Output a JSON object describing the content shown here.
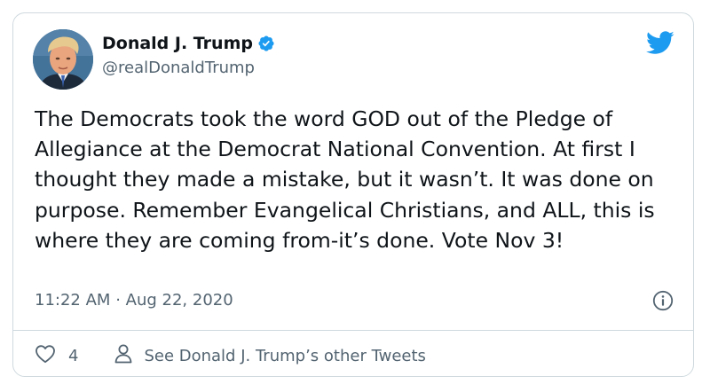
{
  "user": {
    "display_name": "Donald J. Trump",
    "handle": "@realDonaldTrump",
    "verified": true
  },
  "tweet": {
    "text": "The Democrats took the word GOD out of the Pledge of Allegiance at the Democrat National Convention. At first I thought they made a mistake, but it wasn’t. It was done on purpose. Remember Evangelical Christians, and ALL, this is where they are coming from-it’s done. Vote Nov 3!",
    "time": "11:22 AM",
    "separator": "·",
    "date": "Aug 22, 2020"
  },
  "actions": {
    "like_count": "4",
    "see_other_label": "See Donald J. Trump’s other Tweets"
  },
  "icons": {
    "twitter_bird": "twitter-bird-icon",
    "verified": "verified-badge-icon",
    "info": "info-icon",
    "heart": "heart-icon",
    "person": "person-icon"
  },
  "colors": {
    "twitter_blue": "#1d9bf0",
    "text_primary": "#0f1419",
    "text_secondary": "#536471",
    "border": "#cfd9de"
  }
}
